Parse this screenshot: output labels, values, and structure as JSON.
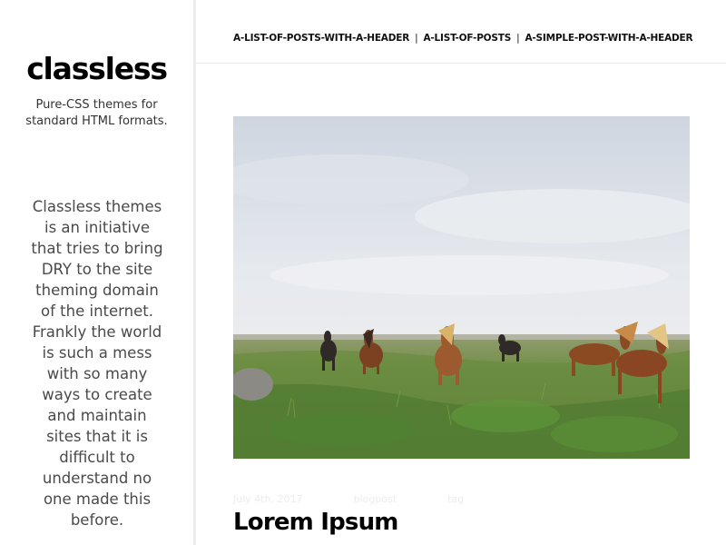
{
  "sidebar": {
    "title": "classless",
    "tagline": "Pure-CSS themes for standard HTML formats.",
    "description": "Classless themes is an initiative that tries to bring DRY to the site theming domain of the internet. Frankly the world is such a mess with so many ways to create and maintain sites that it is difficult to understand no one made this before."
  },
  "nav": {
    "links": [
      {
        "label": "A-LIST-OF-POSTS-WITH-A-HEADER"
      },
      {
        "label": "A-LIST-OF-POSTS"
      },
      {
        "label": "A-SIMPLE-POST-WITH-A-HEADER"
      }
    ],
    "separator": "|"
  },
  "post": {
    "image_subject": "horses-on-grassy-field",
    "date": "July 4th, 2017",
    "category": "blogpost",
    "tag": "tag",
    "title": "Lorem Ipsum"
  },
  "colors": {
    "sidebar_border": "#ececec",
    "text": "#1a1a1a",
    "meta_text": "#ececec",
    "grass": "#5f8a3a",
    "sky": "#e4e8ee"
  }
}
